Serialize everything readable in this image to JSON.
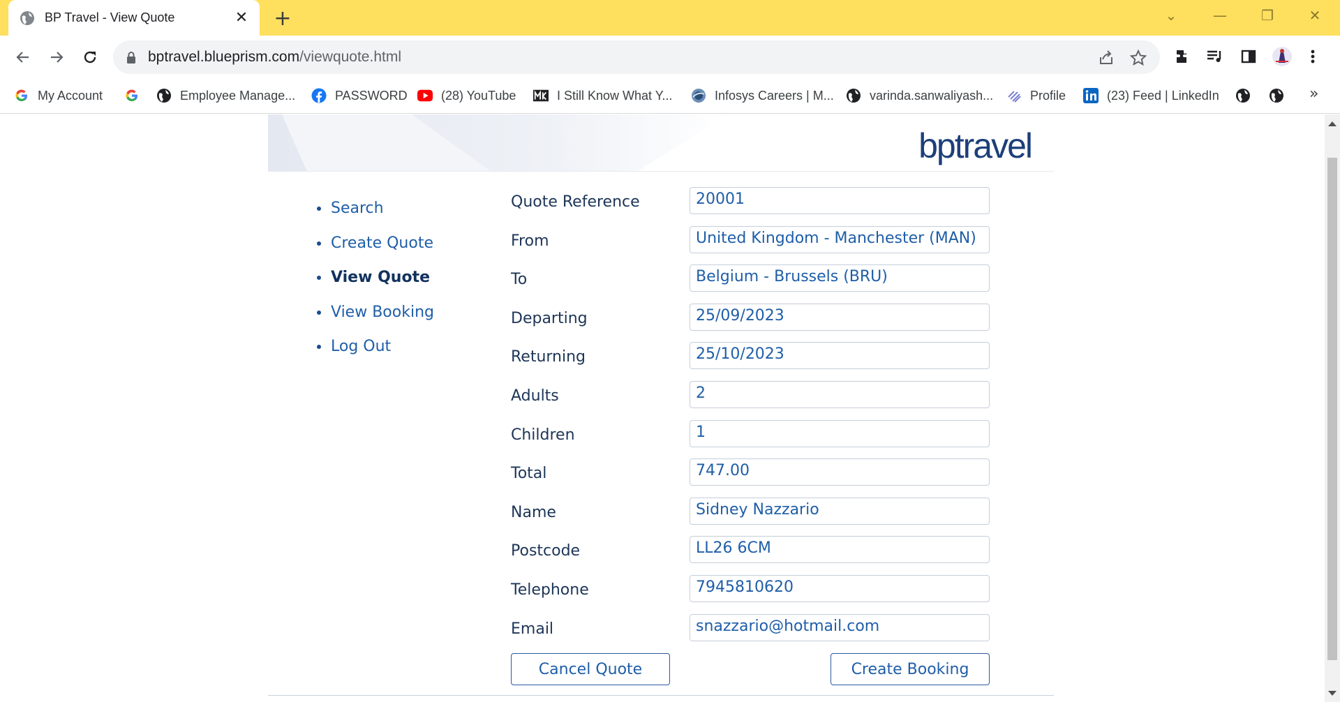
{
  "browser": {
    "tab_title": "BP Travel - View Quote",
    "tab_close": "✕",
    "new_tab": "+",
    "url_host": "bptravel.blueprism.com",
    "url_path": "/viewquote.html",
    "window_controls": [
      "⌄",
      "—",
      "❐",
      "✕"
    ]
  },
  "bookmarks": [
    {
      "label": "My Account",
      "icon": "google-icon"
    },
    {
      "label": "",
      "icon": "google-icon"
    },
    {
      "label": "Employee Manage...",
      "icon": "globe-icon"
    },
    {
      "label": "PASSWORD",
      "icon": "facebook-icon"
    },
    {
      "label": "(28) YouTube",
      "icon": "youtube-icon"
    },
    {
      "label": "I Still Know What Y...",
      "icon": "movie-site-icon"
    },
    {
      "label": "Infosys Careers | M...",
      "icon": "infosys-icon"
    },
    {
      "label": "varinda.sanwaliyash...",
      "icon": "globe-icon"
    },
    {
      "label": "Profile",
      "icon": "profile-site-icon"
    },
    {
      "label": "(23) Feed | LinkedIn",
      "icon": "linkedin-icon"
    },
    {
      "label": "",
      "icon": "globe-icon"
    },
    {
      "label": "",
      "icon": "globe-icon"
    }
  ],
  "bookmarks_more": "»",
  "site": {
    "logo": "bptravel",
    "nav": [
      {
        "label": "Search",
        "active": false
      },
      {
        "label": "Create Quote",
        "active": false
      },
      {
        "label": "View Quote",
        "active": true
      },
      {
        "label": "View Booking",
        "active": false
      },
      {
        "label": "Log Out",
        "active": false
      }
    ],
    "fields": [
      {
        "label": "Quote Reference",
        "value": "20001"
      },
      {
        "label": "From",
        "value": "United Kingdom - Manchester (MAN)"
      },
      {
        "label": "To",
        "value": "Belgium - Brussels (BRU)"
      },
      {
        "label": "Departing",
        "value": "25/09/2023"
      },
      {
        "label": "Returning",
        "value": "25/10/2023"
      },
      {
        "label": "Adults",
        "value": "2"
      },
      {
        "label": "Children",
        "value": "1"
      },
      {
        "label": "Total",
        "value": "747.00"
      },
      {
        "label": "Name",
        "value": "Sidney Nazzario"
      },
      {
        "label": "Postcode",
        "value": "LL26 6CM"
      },
      {
        "label": "Telephone",
        "value": "7945810620"
      },
      {
        "label": "Email",
        "value": "snazzario@hotmail.com"
      }
    ],
    "buttons": {
      "cancel": "Cancel Quote",
      "create": "Create Booking"
    }
  },
  "colors": {
    "tabbar": "#fedf5e",
    "link": "#1f5ea8",
    "logo": "#1c3f7a"
  }
}
